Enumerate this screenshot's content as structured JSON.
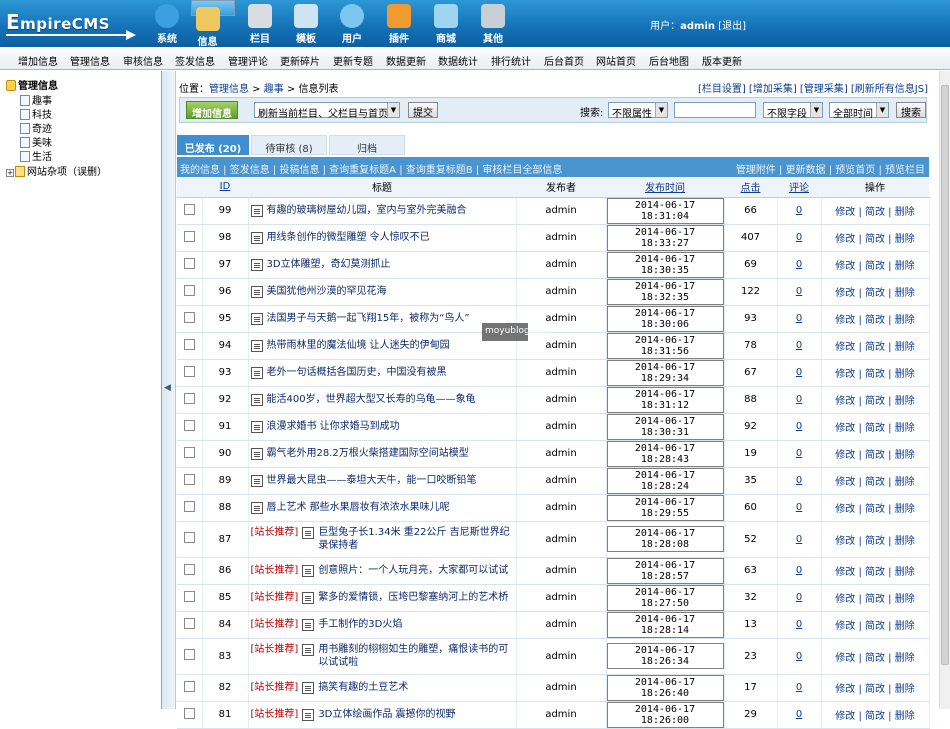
{
  "logo": {
    "first": "E",
    "rest": "mpireCMS"
  },
  "nav": [
    {
      "label": "系统",
      "icon": "globe-icon",
      "color": "#3aa0e0"
    },
    {
      "label": "信息",
      "icon": "pencil-icon",
      "color": "#f0c860"
    },
    {
      "label": "栏目",
      "icon": "folder-icon",
      "color": "#d9dde2"
    },
    {
      "label": "模板",
      "icon": "window-icon",
      "color": "#cfe3f2"
    },
    {
      "label": "用户",
      "icon": "user-icon",
      "color": "#7bc7ef"
    },
    {
      "label": "插件",
      "icon": "tools-icon",
      "color": "#f09a30"
    },
    {
      "label": "商城",
      "icon": "card-icon",
      "color": "#9fd4f2"
    },
    {
      "label": "其他",
      "icon": "gear-icon",
      "color": "#c8cfd6"
    }
  ],
  "user": {
    "prefix": "用户：",
    "name": "admin",
    "logout": "[退出]"
  },
  "menubar": [
    "增加信息",
    "管理信息",
    "审核信息",
    "签发信息",
    "管理评论",
    "更新碎片",
    "更新专题",
    "数据更新",
    "数据统计",
    "排行统计",
    "后台首页",
    "网站首页",
    "后台地图",
    "版本更新"
  ],
  "tree": {
    "root": "管理信息",
    "items": [
      "趣事",
      "科技",
      "奇迹",
      "美味",
      "生活"
    ],
    "other": "网站杂项（误删）"
  },
  "crumb": {
    "label": "位置：",
    "a": "管理信息",
    "sep1": " > ",
    "b": "趣事",
    "sep2": " > ",
    "c": "信息列表"
  },
  "crumbRight": "[栏目设置] [增加采集] [管理采集] [刷新所有信息JS]",
  "toolbar": {
    "add": "增加信息",
    "refresh_select": "刷新当前栏目、父栏目与首页",
    "submit": "提交",
    "search_label": "搜索:",
    "attr_select": "不限属性",
    "field_select": "不限字段",
    "time_select": "全部时间",
    "search_btn": "搜索"
  },
  "tabs": [
    {
      "label": "已发布 (20)"
    },
    {
      "label": "待审核 (8)"
    },
    {
      "label": "归档"
    }
  ],
  "links_left": "我的信息 | 签发信息 | 投稿信息 | 查询重复标题A | 查询重复标题B | 审核栏目全部信息",
  "links_right": "管理附件 | 更新数据 | 预览首页 | 预览栏目",
  "headers": {
    "id": "ID",
    "title": "标题",
    "author": "发布者",
    "time": "发布时间",
    "clicks": "点击",
    "comments": "评论",
    "ops": "操作"
  },
  "rec_tag": "[站长推荐]",
  "ops": "修改 | 简改 | 删除",
  "watermark": "moyublog.com",
  "rows": [
    {
      "id": "99",
      "title": "有趣的玻璃树屋幼儿园，室内与室外完美融合",
      "rec": false,
      "author": "admin",
      "time": "2014-06-17 18:31:04",
      "clicks": "66",
      "comments": "0",
      "h": 26
    },
    {
      "id": "98",
      "title": "用线条创作的微型雕塑 令人惊叹不已",
      "rec": false,
      "author": "admin",
      "time": "2014-06-17 18:33:27",
      "clicks": "407",
      "comments": "0",
      "h": 26
    },
    {
      "id": "97",
      "title": "3D立体雕塑，奇幻莫测抓止",
      "rec": false,
      "author": "admin",
      "time": "2014-06-17 18:30:35",
      "clicks": "69",
      "comments": "0",
      "h": 26
    },
    {
      "id": "96",
      "title": "美国犹他州沙漠的罕见花海",
      "rec": false,
      "author": "admin",
      "time": "2014-06-17 18:32:35",
      "clicks": "122",
      "comments": "0",
      "h": 26
    },
    {
      "id": "95",
      "title": "法国男子与天鹅一起飞翔15年，被称为“鸟人”",
      "rec": false,
      "author": "admin",
      "time": "2014-06-17 18:30:06",
      "clicks": "93",
      "comments": "0",
      "h": 26
    },
    {
      "id": "94",
      "title": "热带雨林里的魔法仙境 让人迷失的伊甸园",
      "rec": false,
      "author": "admin",
      "time": "2014-06-17 18:31:56",
      "clicks": "78",
      "comments": "0",
      "h": 26
    },
    {
      "id": "93",
      "title": "老外一句话概括各国历史，中国没有被黑",
      "rec": false,
      "author": "admin",
      "time": "2014-06-17 18:29:34",
      "clicks": "67",
      "comments": "0",
      "h": 26
    },
    {
      "id": "92",
      "title": "能活400岁，世界超大型又长寿的乌龟——象龟",
      "rec": false,
      "author": "admin",
      "time": "2014-06-17 18:31:12",
      "clicks": "88",
      "comments": "0",
      "h": 26
    },
    {
      "id": "91",
      "title": "浪漫求婚书 让你求婚马到成功",
      "rec": false,
      "author": "admin",
      "time": "2014-06-17 18:30:31",
      "clicks": "92",
      "comments": "0",
      "h": 26
    },
    {
      "id": "90",
      "title": "霸气老外用28.2万根火柴搭建国际空间站模型",
      "rec": false,
      "author": "admin",
      "time": "2014-06-17 18:28:43",
      "clicks": "19",
      "comments": "0",
      "h": 26
    },
    {
      "id": "89",
      "title": "世界最大昆虫——泰坦大天牛，能一口咬断铅笔",
      "rec": false,
      "author": "admin",
      "time": "2014-06-17 18:28:24",
      "clicks": "35",
      "comments": "0",
      "h": 26
    },
    {
      "id": "88",
      "title": "唇上艺术 那些水果唇妆有浓浓水果味儿呢",
      "rec": false,
      "author": "admin",
      "time": "2014-06-17 18:29:55",
      "clicks": "60",
      "comments": "0",
      "h": 26
    },
    {
      "id": "87",
      "title": "巨型兔子长1.34米 重22公斤 吉尼斯世界纪录保持者",
      "rec": true,
      "author": "admin",
      "time": "2014-06-17 18:28:08",
      "clicks": "52",
      "comments": "0",
      "h": 36
    },
    {
      "id": "86",
      "title": "创意照片：一个人玩月亮，大家都可以试试",
      "rec": true,
      "author": "admin",
      "time": "2014-06-17 18:28:57",
      "clicks": "63",
      "comments": "0",
      "h": 26
    },
    {
      "id": "85",
      "title": "繁多的爱情锁，压垮巴黎塞纳河上的艺术桥",
      "rec": true,
      "author": "admin",
      "time": "2014-06-17 18:27:50",
      "clicks": "32",
      "comments": "0",
      "h": 26
    },
    {
      "id": "84",
      "title": "手工制作的3D火焰",
      "rec": true,
      "author": "admin",
      "time": "2014-06-17 18:28:14",
      "clicks": "13",
      "comments": "0",
      "h": 26
    },
    {
      "id": "83",
      "title": "用书雕刻的栩栩如生的雕塑，痛恨读书的可以试试啦",
      "rec": true,
      "author": "admin",
      "time": "2014-06-17 18:26:34",
      "clicks": "23",
      "comments": "0",
      "h": 36
    },
    {
      "id": "82",
      "title": "搞笑有趣的土豆艺术",
      "rec": true,
      "author": "admin",
      "time": "2014-06-17 18:26:40",
      "clicks": "17",
      "comments": "0",
      "h": 26
    },
    {
      "id": "81",
      "title": "3D立体绘画作品 震撼你的视野",
      "rec": true,
      "author": "admin",
      "time": "2014-06-17 18:26:00",
      "clicks": "29",
      "comments": "0",
      "h": 26
    }
  ]
}
